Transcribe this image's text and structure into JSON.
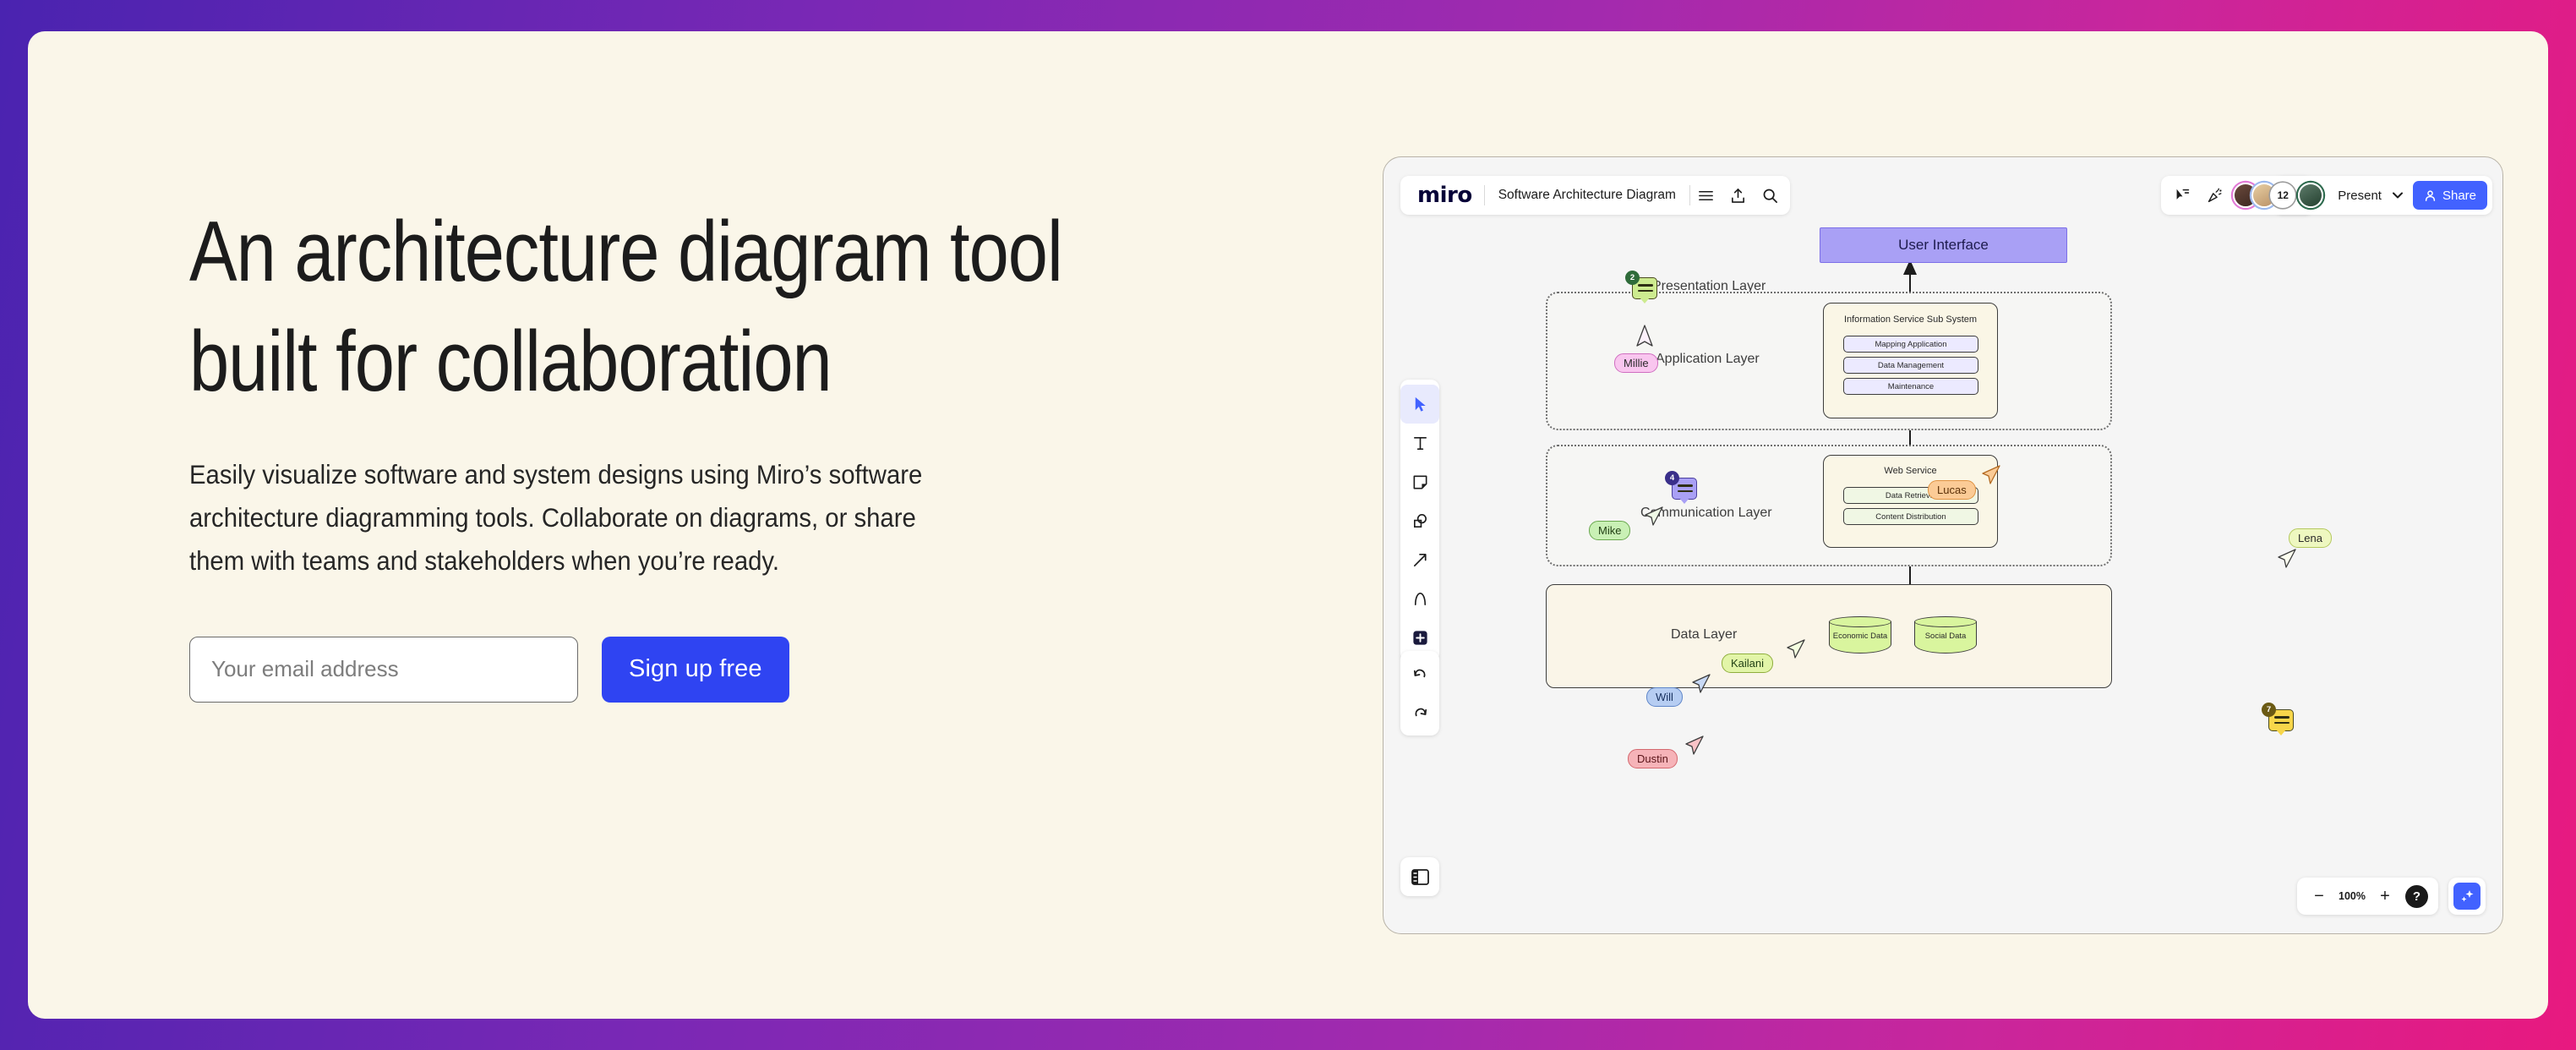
{
  "hero": {
    "headline": "An architecture diagram tool built for collaboration",
    "subhead": "Easily visualize software and system designs using Miro’s software architecture diagramming tools. Collaborate on diagrams, or share them with teams and stakeholders when you’re ready.",
    "email_placeholder": "Your email address",
    "email_value": "",
    "signup_label": "Sign up free",
    "bg_color": "#faf6e9",
    "accent_color": "#2f44f2"
  },
  "app": {
    "logo": "miro",
    "board_title": "Software Architecture Diagram",
    "header_icons": [
      "menu-icon",
      "upload-icon",
      "search-icon"
    ],
    "shapes_icon": "shapes-icon",
    "cursor_chat_icon": "cursor-chat-icon",
    "celebrate_icon": "celebrate-icon",
    "avatar_overflow_count": "12",
    "present_label": "Present",
    "present_chevron": "chevron-down-icon",
    "share_label": "Share",
    "share_color": "#4262ff",
    "toolbar": [
      {
        "name": "select-tool",
        "icon": "cursor-icon",
        "active": true
      },
      {
        "name": "text-tool",
        "icon": "text-icon",
        "active": false
      },
      {
        "name": "sticky-note-tool",
        "icon": "sticky-note-icon",
        "active": false
      },
      {
        "name": "shapes-tool",
        "icon": "shapes-icon",
        "active": false
      },
      {
        "name": "connection-tool",
        "icon": "arrow-icon",
        "active": false
      },
      {
        "name": "pen-tool",
        "icon": "pen-icon",
        "active": false
      },
      {
        "name": "more-apps-tool",
        "icon": "plus-icon",
        "active": false
      }
    ],
    "history": [
      {
        "name": "undo-button",
        "icon": "undo-icon"
      },
      {
        "name": "redo-button",
        "icon": "redo-icon"
      }
    ],
    "panel_toggle_icon": "panel-layout-icon",
    "zoom": {
      "minus_label": "−",
      "level": "100%",
      "plus_label": "+",
      "help_label": "?"
    },
    "ai_icon": "sparkle-icon"
  },
  "chart_data": {
    "type": "diagram",
    "title": "Software Architecture Diagram",
    "layers": [
      {
        "name": "Presentation Layer",
        "style": "label-only",
        "nodes": [
          "User Interface"
        ]
      },
      {
        "name": "Application Layer",
        "style": "dashed-group",
        "subsystems": [
          {
            "title": "Information Service Sub System",
            "components": [
              "Mapping Application",
              "Data Management",
              "Maintenance"
            ]
          }
        ]
      },
      {
        "name": "Communication Layer",
        "style": "dashed-group",
        "subsystems": [
          {
            "title": "Web Service",
            "components": [
              "Data Retrieval",
              "Content Distribution"
            ]
          }
        ]
      },
      {
        "name": "Data Layer",
        "style": "solid-group",
        "datastores": [
          "Economic Data",
          "Social Data"
        ]
      }
    ],
    "edges": [
      {
        "from": "Information Service Sub System",
        "to": "User Interface"
      },
      {
        "from": "Web Service",
        "to": "Information Service Sub System"
      },
      {
        "from": "Data Layer",
        "to": "Web Service"
      }
    ],
    "node_colors": {
      "user_interface": "#a9a0f5",
      "subsystem": "#faf6e6",
      "component_app": "#eceaff",
      "component_web": "#f0f7e4",
      "datastore": "#d9f59e",
      "data_layer": "#faf5e8"
    }
  },
  "collaborators": [
    {
      "name": "Millie",
      "bg": "#f9c6ef",
      "border": "#d06ec0",
      "text": "#2a2a2a"
    },
    {
      "name": "Mike",
      "bg": "#c9f0b5",
      "border": "#6aa84f",
      "text": "#1f3d12"
    },
    {
      "name": "Lucas",
      "bg": "#fbcb96",
      "border": "#e09343",
      "text": "#5a3008"
    },
    {
      "name": "Lena",
      "bg": "#eef7c0",
      "border": "#b5c95e",
      "text": "#2a2a2a"
    },
    {
      "name": "Kailani",
      "bg": "#e2f5a8",
      "border": "#8fae3d",
      "text": "#1f3d12"
    },
    {
      "name": "Will",
      "bg": "#b6cdf2",
      "border": "#5f86c9",
      "text": "#17305e"
    },
    {
      "name": "Dustin",
      "bg": "#f6b3b8",
      "border": "#d4686f",
      "text": "#5a1318"
    }
  ],
  "comments": [
    {
      "id": "comment-millie",
      "count": "2",
      "bg": "#cdeb8f",
      "badge_bg": "#2f6b3a"
    },
    {
      "id": "comment-mike",
      "count": "4",
      "bg": "#a9a0f5",
      "badge_bg": "#3a2f8a"
    },
    {
      "id": "comment-lena",
      "count": "7",
      "bg": "#f7d64a",
      "badge_bg": "#6b5a14"
    }
  ]
}
